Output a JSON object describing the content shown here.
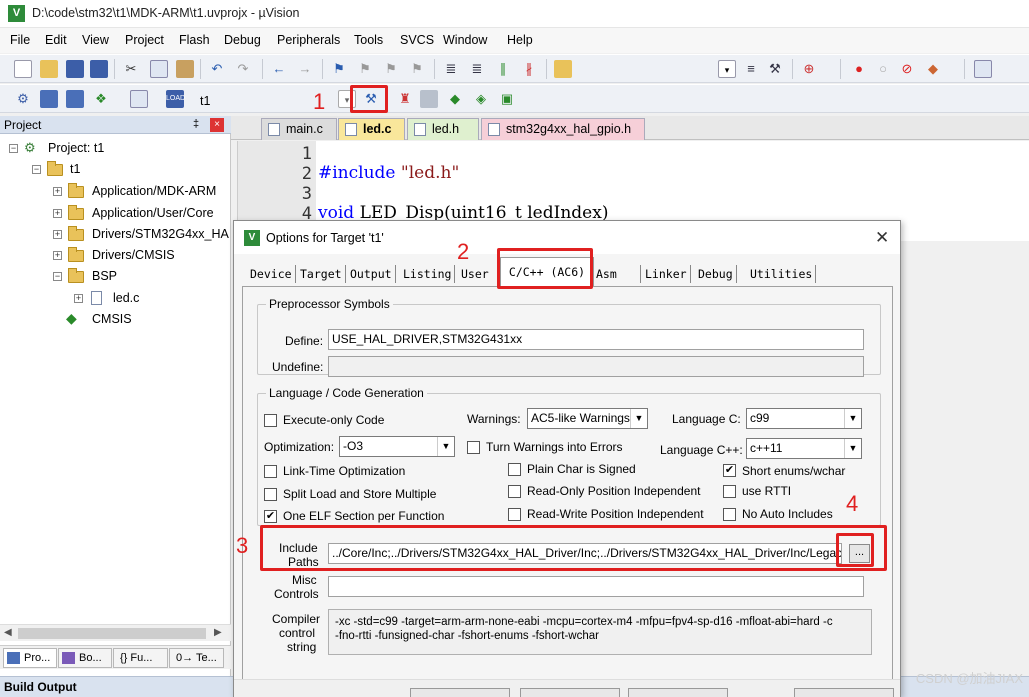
{
  "window": {
    "title": "D:\\code\\stm32\\t1\\MDK-ARM\\t1.uvprojx - µVision",
    "app_icon": "V"
  },
  "menu": [
    "File",
    "Edit",
    "View",
    "Project",
    "Flash",
    "Debug",
    "Peripherals",
    "Tools",
    "SVCS",
    "Window",
    "Help"
  ],
  "toolbar2": {
    "target_name": "t1"
  },
  "project_pane": {
    "title": "Project",
    "pin": "‡",
    "close": "×",
    "tree": {
      "project": "Project: t1",
      "target": "t1",
      "groups": [
        "Application/MDK-ARM",
        "Application/User/Core",
        "Drivers/STM32G4xx_HA",
        "Drivers/CMSIS",
        "BSP"
      ],
      "file": "led.c",
      "cmsis": "CMSIS"
    },
    "bottom_tabs": [
      "Pro...",
      "Bo...",
      "{} Fu...",
      "0→ Te..."
    ]
  },
  "build_output": "Build Output",
  "editor_tabs": [
    "main.c",
    "led.c",
    "led.h",
    "stm32g4xx_hal_gpio.h"
  ],
  "editor": {
    "lines": [
      "1",
      "2",
      "3",
      "4"
    ],
    "line2_kw": "#include",
    "line2_str": "\"led.h\"",
    "line4_kw": "void",
    "line4_rest": " LED_Disp(uint16_t ledIndex)"
  },
  "dialog": {
    "icon": "V",
    "title": "Options for Target 't1'",
    "close": "✕",
    "tabs": [
      "Device",
      "Target",
      "Output",
      "Listing",
      "User",
      "C/C++ (AC6)",
      "Asm",
      "Linker",
      "Debug",
      "Utilities"
    ],
    "preprocessor": {
      "group_label": "Preprocessor Symbols",
      "define_label": "Define:",
      "define_value": "USE_HAL_DRIVER,STM32G431xx",
      "undefine_label": "Undefine:",
      "undefine_value": ""
    },
    "language": {
      "group_label": "Language / Code Generation",
      "execute_only": "Execute-only Code",
      "warnings_label": "Warnings:",
      "warnings_value": "AC5-like Warnings",
      "lang_c_label": "Language C:",
      "lang_c_value": "c99",
      "optimization_label": "Optimization:",
      "optimization_value": "-O3",
      "turn_warnings": "Turn Warnings into Errors",
      "lang_cpp_label": "Language C++:",
      "lang_cpp_value": "c++11",
      "lto": "Link-Time Optimization",
      "plain_char": "Plain Char is Signed",
      "short_enums": "Short enums/wchar",
      "split_load": "Split Load and Store Multiple",
      "ro_pi": "Read-Only Position Independent",
      "rtti": "use RTTI",
      "one_elf": "One ELF Section per Function",
      "rw_pi": "Read-Write Position Independent",
      "no_auto": "No Auto Includes",
      "check_mark": "✔"
    },
    "include_label_1": "Include",
    "include_label_2": "Paths",
    "include_value": "../Core/Inc;../Drivers/STM32G4xx_HAL_Driver/Inc;../Drivers/STM32G4xx_HAL_Driver/Inc/Legacy",
    "browse": "...",
    "misc_label_1": "Misc",
    "misc_label_2": "Controls",
    "misc_value": "",
    "compiler_label_1": "Compiler",
    "compiler_label_2": "control",
    "compiler_label_3": "string",
    "compiler_line1": "-xc -std=c99 -target=arm-arm-none-eabi -mcpu=cortex-m4 -mfpu=fpv4-sp-d16 -mfloat-abi=hard -c",
    "compiler_line2": "-fno-rtti -funsigned-char -fshort-enums -fshort-wchar"
  },
  "annotations": [
    "1",
    "2",
    "3",
    "4"
  ],
  "watermark": "CSDN @加油JIAX",
  "colors": {
    "accent_red": "#e02020",
    "keyword_blue": "#0000ff",
    "string_red": "#8b1a1a"
  }
}
